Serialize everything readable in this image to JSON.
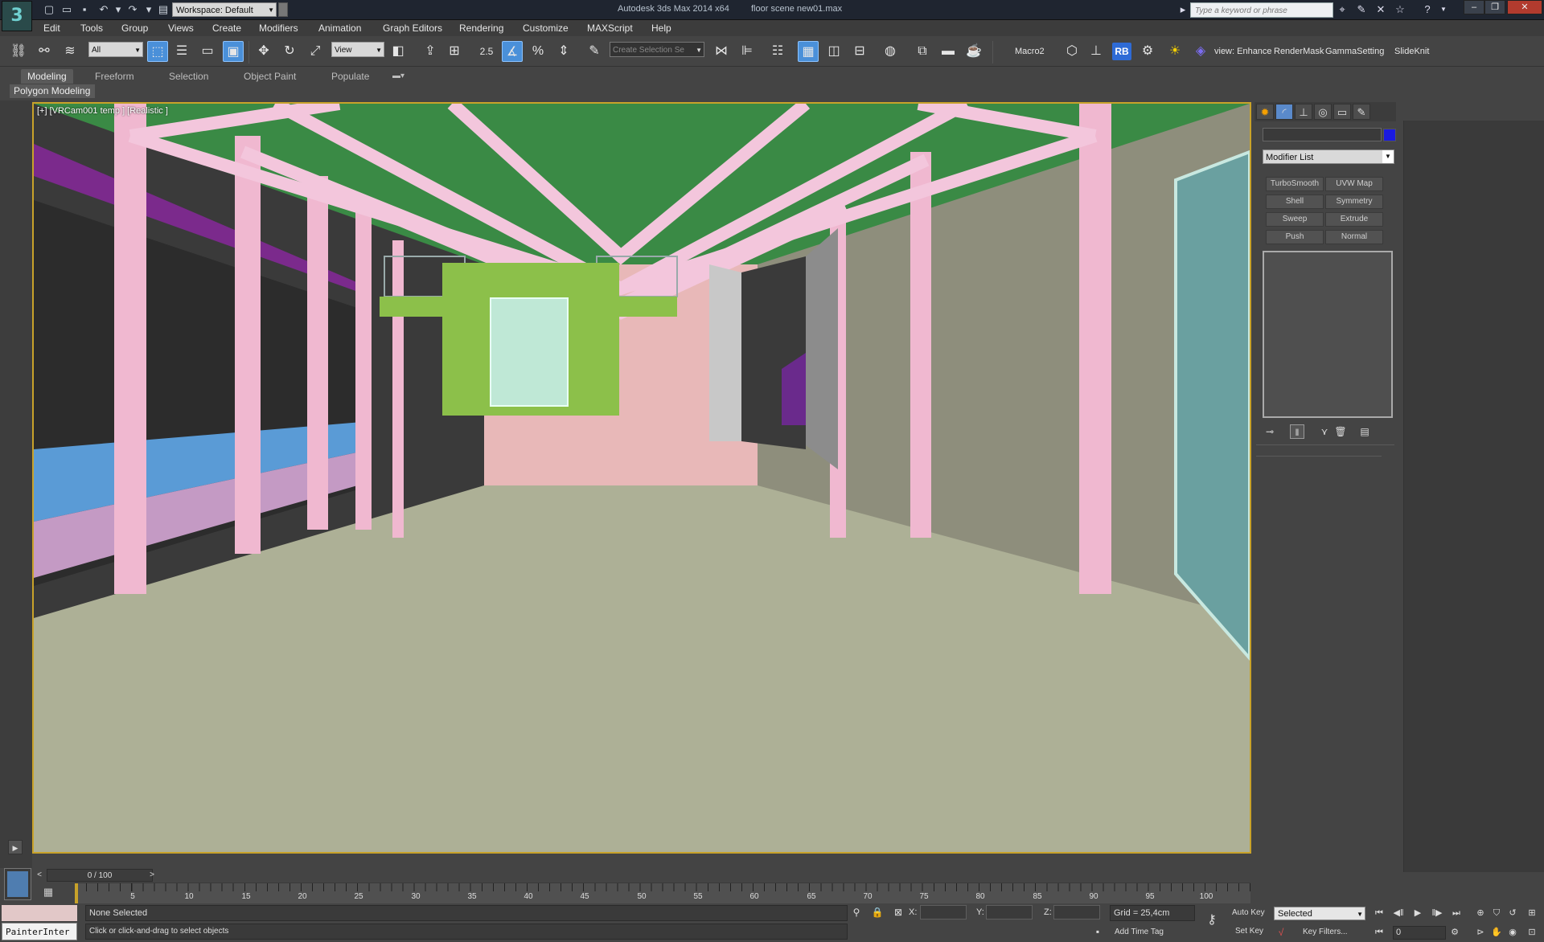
{
  "app": {
    "title": "Autodesk 3ds Max  2014 x64",
    "file": "floor scene new01.max",
    "workspace": "Workspace: Default",
    "search_placeholder": "Type a keyword or phrase"
  },
  "menu": [
    "Edit",
    "Tools",
    "Group",
    "Views",
    "Create",
    "Modifiers",
    "Animation",
    "Graph Editors",
    "Rendering",
    "Customize",
    "MAXScript",
    "Help"
  ],
  "toolbar": {
    "filter": "All",
    "ref_coord": "View",
    "snap_value": "2.5",
    "selection_set": "Create Selection Se",
    "macro": "Macro2",
    "rb": "RB",
    "text_items": [
      "view: Enhance",
      "RenderMask",
      "GammaSetting",
      "SlideKnit"
    ]
  },
  "ribbon": {
    "tabs": [
      "Modeling",
      "Freeform",
      "Selection",
      "Object Paint",
      "Populate"
    ],
    "active_tab": "Modeling",
    "sub": "Polygon Modeling"
  },
  "viewport": {
    "label": "[+] [VRCam001 temp ] [Realistic ]"
  },
  "command_panel": {
    "modifier_list": "Modifier List",
    "modifier_buttons": [
      "TurboSmooth",
      "UVW Map",
      "Shell",
      "Symmetry",
      "Sweep",
      "Extrude",
      "Push",
      "Normal"
    ],
    "object_color": "#1a1adf"
  },
  "timeline": {
    "frame": "0 / 100",
    "ticks": [
      "5",
      "10",
      "15",
      "20",
      "25",
      "30",
      "35",
      "40",
      "45",
      "50",
      "55",
      "60",
      "65",
      "70",
      "75",
      "80",
      "85",
      "90",
      "95",
      "100"
    ]
  },
  "status": {
    "painter_label": "PainterInter",
    "selection": "None Selected",
    "prompt": "Click or click-and-drag to select objects",
    "x_label": "X:",
    "y_label": "Y:",
    "z_label": "Z:",
    "grid": "Grid = 25,4cm",
    "add_time_tag": "Add Time Tag",
    "auto_key": "Auto Key",
    "set_key": "Set Key",
    "key_mode": "Selected",
    "key_filters": "Key Filters...",
    "frame_input": "0"
  }
}
